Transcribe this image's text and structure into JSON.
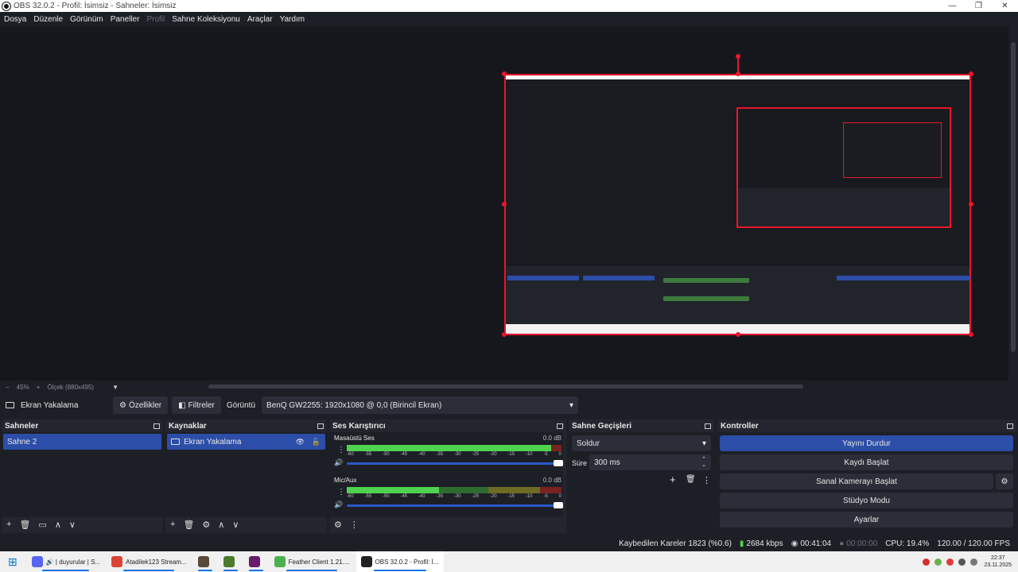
{
  "window": {
    "title": "OBS 32.0.2 - Profil: İsimsiz - Sahneler: İsimsiz",
    "min_glyph": "—",
    "max_glyph": "❐",
    "close_glyph": "✕"
  },
  "menu": [
    "Dosya",
    "Düzenle",
    "Görünüm",
    "Paneller",
    "Profil",
    "Sahne Koleksiyonu",
    "Araçlar",
    "Yardım"
  ],
  "zoom": {
    "minus": "−",
    "percent": "45%",
    "plus": "+",
    "scale": "Ölçek (880x495)",
    "arrow": "▼"
  },
  "source_toolbar": {
    "source_name": "Ekran Yakalama",
    "properties": "Özellikler",
    "filters": "Filtreler",
    "display_label": "Görüntü",
    "display_value": "BenQ GW2255: 1920x1080 @ 0,0 (Birincil Ekran)",
    "arrow": "▾"
  },
  "scenes": {
    "title": "Sahneler",
    "items": [
      "Sahne 2"
    ],
    "footer": [
      "+",
      "🗑",
      "▭",
      "∧",
      "∨"
    ]
  },
  "sources": {
    "title": "Kaynaklar",
    "items": [
      "Ekran Yakalama"
    ],
    "eye": "👁",
    "lock": "🔓",
    "footer": [
      "+",
      "🗑",
      "⚙",
      "∧",
      "∨"
    ]
  },
  "mixer": {
    "title": "Ses Karıştırıcı",
    "channels": [
      {
        "name": "Masaüstü Ses",
        "db": "0.0 dB",
        "level": 0.95
      },
      {
        "name": "Mic/Aux",
        "db": "0.0 dB",
        "level": 0.43
      }
    ],
    "ticks": [
      "-60",
      "-55",
      "-50",
      "-45",
      "-40",
      "-35",
      "-30",
      "-25",
      "-20",
      "-15",
      "-10",
      "-5",
      "0"
    ],
    "footer": [
      "⚙",
      "⋮"
    ],
    "menu_glyph": "⋮",
    "speaker_glyph": "🔊"
  },
  "transitions": {
    "title": "Sahne Geçişleri",
    "selected": "Soldur",
    "duration_label": "Süre",
    "duration_value": "300 ms",
    "add": "+",
    "remove": "🗑",
    "more": "⋮",
    "arrow": "▾",
    "spin_up": "⌃",
    "spin_down": "⌄"
  },
  "controls": {
    "title": "Kontroller",
    "stop_stream": "Yayını Durdur",
    "start_recording": "Kaydı Başlat",
    "virtual_camera": "Sanal Kamerayı Başlat",
    "studio_mode": "Stüdyo Modu",
    "settings": "Ayarlar",
    "gear": "⚙"
  },
  "status": {
    "dropped_frames": "Kaybedilen Kareler 1823 (%0.6)",
    "bitrate": "2684 kbps",
    "stream_time": "00:41:04",
    "record_time": "00:00:00",
    "cpu": "CPU: 19.4%",
    "fps": "120.00 / 120.00 FPS"
  },
  "taskbar": {
    "start_glyph": "⊞",
    "items": [
      {
        "label": "🔊 | duyurular | S...",
        "color": "#5865f2",
        "active": false
      },
      {
        "label": "Atadilek123 Stream...",
        "color": "#db4437",
        "active": false
      },
      {
        "label": "",
        "color": "#5a4a3a",
        "active": false
      },
      {
        "label": "",
        "color": "#4a7a2a",
        "active": false
      },
      {
        "label": "",
        "color": "#6a1b6a",
        "active": false
      },
      {
        "label": "Feather Client 1.21....",
        "color": "#4caf50",
        "active": false
      },
      {
        "label": "OBS 32.0.2 - Profil: İ...",
        "color": "#222222",
        "active": true
      }
    ],
    "clock_time": "22:37",
    "clock_date": "23.11.2025"
  },
  "colors": {
    "accent": "#2c4ea8",
    "selection_border": "#e8162b",
    "meter_green": "#4fd34f"
  }
}
